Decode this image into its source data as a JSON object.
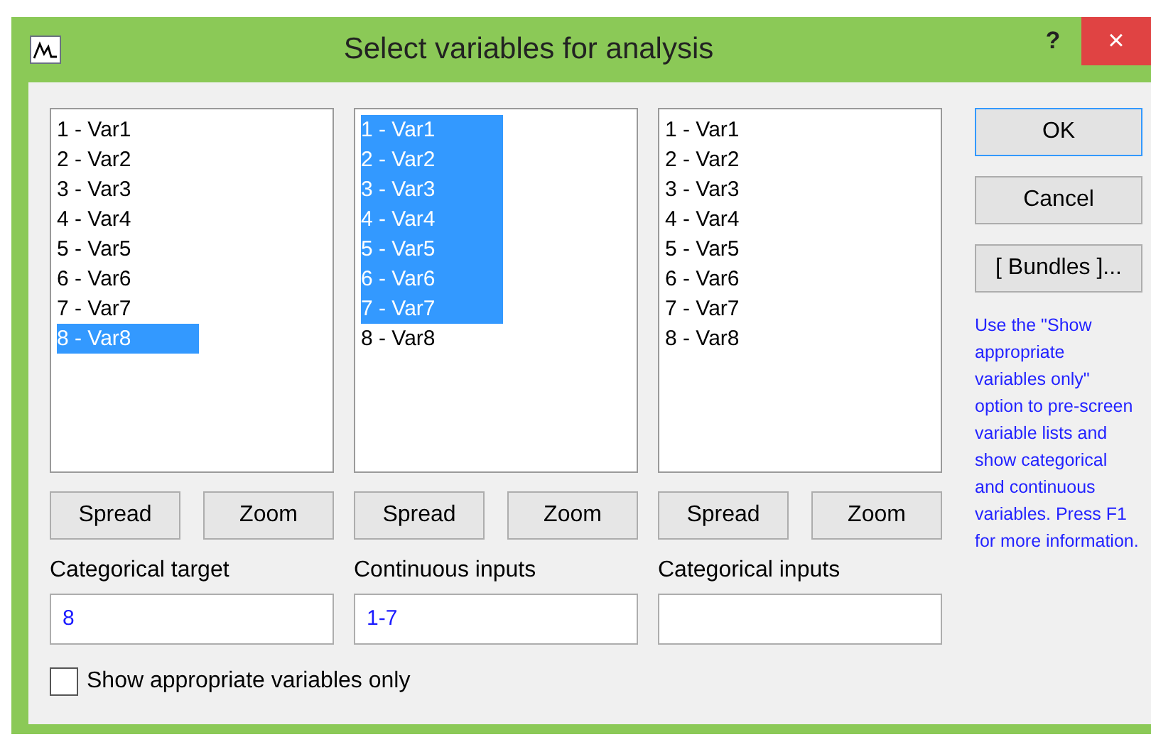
{
  "window": {
    "title": "Select variables for analysis",
    "help_button": "?",
    "close_button": "×"
  },
  "lists": [
    {
      "items": [
        {
          "label": "1 - Var1",
          "selected": false
        },
        {
          "label": "2 - Var2",
          "selected": false
        },
        {
          "label": "3 - Var3",
          "selected": false
        },
        {
          "label": "4 - Var4",
          "selected": false
        },
        {
          "label": "5 - Var5",
          "selected": false
        },
        {
          "label": "6 - Var6",
          "selected": false
        },
        {
          "label": "7 - Var7",
          "selected": false
        },
        {
          "label": "8 - Var8",
          "selected": true
        }
      ],
      "buttons": [
        "Spread",
        "Zoom"
      ],
      "field_label": "Categorical target",
      "field_value": "8"
    },
    {
      "items": [
        {
          "label": "1 - Var1",
          "selected": true
        },
        {
          "label": "2 - Var2",
          "selected": true
        },
        {
          "label": "3 - Var3",
          "selected": true
        },
        {
          "label": "4 - Var4",
          "selected": true
        },
        {
          "label": "5 - Var5",
          "selected": true
        },
        {
          "label": "6 - Var6",
          "selected": true
        },
        {
          "label": "7 - Var7",
          "selected": true
        },
        {
          "label": "8 - Var8",
          "selected": false
        }
      ],
      "buttons": [
        "Spread",
        "Zoom"
      ],
      "field_label": "Continuous inputs",
      "field_value": "1-7"
    },
    {
      "items": [
        {
          "label": "1 - Var1",
          "selected": false
        },
        {
          "label": "2 - Var2",
          "selected": false
        },
        {
          "label": "3 - Var3",
          "selected": false
        },
        {
          "label": "4 - Var4",
          "selected": false
        },
        {
          "label": "5 - Var5",
          "selected": false
        },
        {
          "label": "6 - Var6",
          "selected": false
        },
        {
          "label": "7 - Var7",
          "selected": false
        },
        {
          "label": "8 - Var8",
          "selected": false
        }
      ],
      "buttons": [
        "Spread",
        "Zoom"
      ],
      "field_label": "Categorical inputs"
    }
  ],
  "actions": [
    {
      "label": "OK",
      "default": true
    },
    {
      "label": "Cancel",
      "default": false
    },
    {
      "label": "[ Bundles ]...",
      "default": false
    }
  ],
  "help_text": "Use the \"Show appropriate variables only\" option to pre-screen variable lists and show categorical and continuous variables. Press F1 for more information.",
  "show_appropriate": {
    "label": "Show appropriate variables only",
    "checked": false
  }
}
